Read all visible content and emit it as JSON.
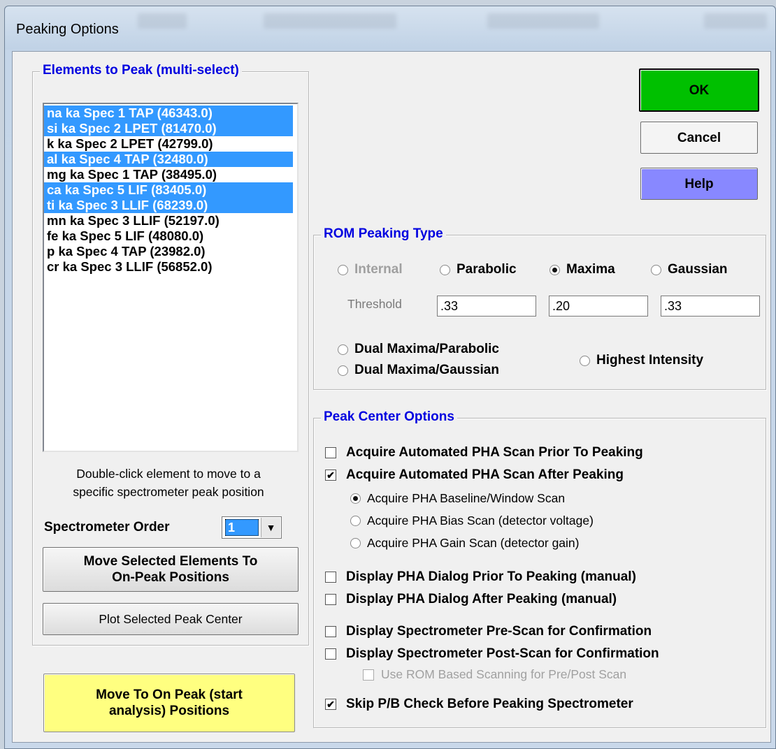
{
  "window": {
    "title": "Peaking Options"
  },
  "elements_group": {
    "legend": "Elements to Peak (multi-select)",
    "items": [
      {
        "label": "na ka Spec 1 TAP (46343.0)",
        "selected": true
      },
      {
        "label": "si ka Spec 2 LPET (81470.0)",
        "selected": true
      },
      {
        "label": "k ka Spec 2 LPET (42799.0)",
        "selected": false
      },
      {
        "label": "al ka Spec 4 TAP (32480.0)",
        "selected": true
      },
      {
        "label": "mg ka Spec 1 TAP (38495.0)",
        "selected": false
      },
      {
        "label": "ca ka Spec 5 LIF (83405.0)",
        "selected": true
      },
      {
        "label": "ti ka Spec 3 LLIF (68239.0)",
        "selected": true
      },
      {
        "label": "mn ka Spec 3 LLIF (52197.0)",
        "selected": false
      },
      {
        "label": "fe ka Spec 5 LIF (48080.0)",
        "selected": false
      },
      {
        "label": "p ka Spec 4 TAP (23982.0)",
        "selected": false
      },
      {
        "label": "cr ka Spec 3 LLIF (56852.0)",
        "selected": false
      }
    ],
    "hint_line1": "Double-click element to move to a",
    "hint_line2": "specific spectrometer peak position",
    "order_label": "Spectrometer Order",
    "order_value": "1",
    "move_selected_line1": "Move Selected Elements To",
    "move_selected_line2": "On-Peak Positions",
    "plot_button": "Plot Selected Peak Center"
  },
  "move_to_on_peak": {
    "line1": "Move To On Peak (start",
    "line2": "analysis) Positions",
    "color": "#ffff80"
  },
  "buttons": {
    "ok": "OK",
    "cancel": "Cancel",
    "help": "Help",
    "ok_color": "#00c000",
    "help_color": "#8888ff"
  },
  "rom_group": {
    "legend": "ROM Peaking Type",
    "internal": "Internal",
    "parabolic": "Parabolic",
    "maxima": "Maxima",
    "gaussian": "Gaussian",
    "selected": "Maxima",
    "threshold_label": "Threshold",
    "thresholds": [
      ".33",
      ".20",
      ".33"
    ],
    "dual_maxima_parabolic": "Dual Maxima/Parabolic",
    "dual_maxima_gaussian": "Dual Maxima/Gaussian",
    "highest_intensity": "Highest Intensity"
  },
  "peak_center_group": {
    "legend": "Peak Center Options",
    "pha_prior": {
      "label": "Acquire Automated PHA Scan Prior To Peaking",
      "checked": false
    },
    "pha_after": {
      "label": "Acquire Automated PHA Scan After Peaking",
      "checked": true
    },
    "pha_baseline": {
      "label": "Acquire PHA Baseline/Window Scan",
      "selected": true
    },
    "pha_bias": {
      "label": "Acquire PHA Bias Scan (detector voltage)",
      "selected": false
    },
    "pha_gain": {
      "label": "Acquire PHA Gain Scan (detector gain)",
      "selected": false
    },
    "dialog_prior": {
      "label": "Display PHA Dialog Prior To Peaking (manual)",
      "checked": false
    },
    "dialog_after": {
      "label": "Display PHA Dialog After Peaking (manual)",
      "checked": false
    },
    "pre_scan": {
      "label": "Display Spectrometer Pre-Scan for Confirmation",
      "checked": false
    },
    "post_scan": {
      "label": "Display Spectrometer Post-Scan for Confirmation",
      "checked": false
    },
    "rom_scanning": {
      "label": "Use ROM Based Scanning for Pre/Post Scan",
      "checked": false
    },
    "skip_pb": {
      "label": "Skip P/B Check Before Peaking Spectrometer",
      "checked": true
    }
  }
}
